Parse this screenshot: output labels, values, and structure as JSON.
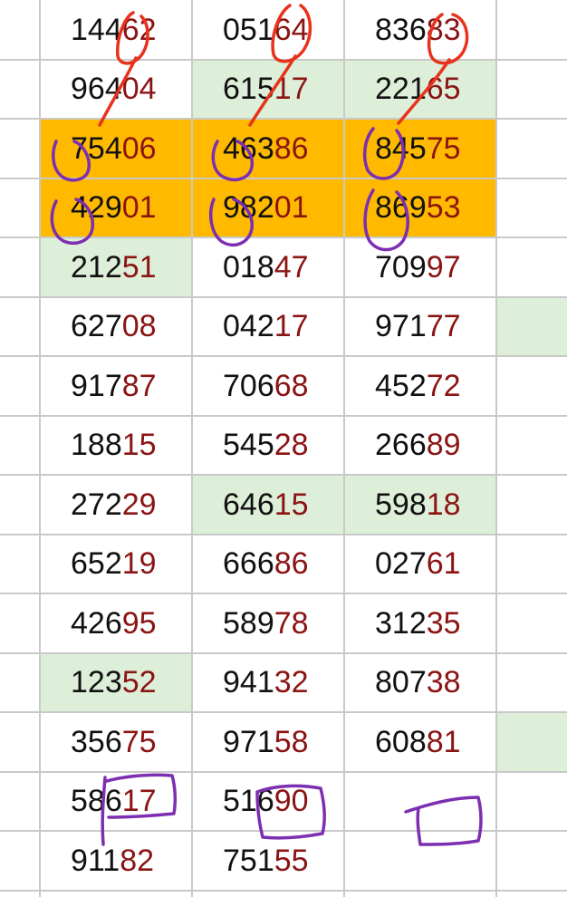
{
  "colors": {
    "grid": "#c9c9c9",
    "high_digits": "#111111",
    "low_digits": "#8b1414",
    "green_fill": "#deefd9",
    "orange_fill": "#ffba00",
    "red_ink": "#e8321c",
    "purple_ink": "#7c2fb0"
  },
  "columns": [
    {
      "cells": [
        {
          "high": "144",
          "low": "62"
        },
        {
          "high": "964",
          "low": "04"
        },
        {
          "high": "754",
          "low": "06",
          "fill": "orange"
        },
        {
          "high": "429",
          "low": "01",
          "fill": "orange"
        },
        {
          "high": "212",
          "low": "51",
          "fill": "green"
        },
        {
          "high": "627",
          "low": "08"
        },
        {
          "high": "917",
          "low": "87"
        },
        {
          "high": "188",
          "low": "15"
        },
        {
          "high": "272",
          "low": "29"
        },
        {
          "high": "652",
          "low": "19"
        },
        {
          "high": "426",
          "low": "95"
        },
        {
          "high": "123",
          "low": "52",
          "fill": "green"
        },
        {
          "high": "356",
          "low": "75"
        },
        {
          "high": "586",
          "low": "17"
        },
        {
          "high": "911",
          "low": "82"
        }
      ]
    },
    {
      "cells": [
        {
          "high": "051",
          "low": "64"
        },
        {
          "high": "615",
          "low": "17",
          "fill": "green"
        },
        {
          "high": "463",
          "low": "86",
          "fill": "orange"
        },
        {
          "high": "982",
          "low": "01",
          "fill": "orange"
        },
        {
          "high": "018",
          "low": "47"
        },
        {
          "high": "042",
          "low": "17"
        },
        {
          "high": "706",
          "low": "68"
        },
        {
          "high": "545",
          "low": "28"
        },
        {
          "high": "646",
          "low": "15",
          "fill": "green"
        },
        {
          "high": "666",
          "low": "86"
        },
        {
          "high": "589",
          "low": "78"
        },
        {
          "high": "941",
          "low": "32"
        },
        {
          "high": "971",
          "low": "58"
        },
        {
          "high": "516",
          "low": "90"
        },
        {
          "high": "751",
          "low": "55"
        }
      ]
    },
    {
      "cells": [
        {
          "high": "836",
          "low": "83"
        },
        {
          "high": "221",
          "low": "65",
          "fill": "green"
        },
        {
          "high": "845",
          "low": "75",
          "fill": "orange"
        },
        {
          "high": "869",
          "low": "53",
          "fill": "orange"
        },
        {
          "high": "709",
          "low": "97"
        },
        {
          "high": "971",
          "low": "77"
        },
        {
          "high": "452",
          "low": "72"
        },
        {
          "high": "266",
          "low": "89"
        },
        {
          "high": "598",
          "low": "18",
          "fill": "green"
        },
        {
          "high": "027",
          "low": "61"
        },
        {
          "high": "312",
          "low": "35"
        },
        {
          "high": "807",
          "low": "38"
        },
        {
          "high": "608",
          "low": "81"
        },
        {
          "high": "",
          "low": ""
        },
        {
          "high": "",
          "low": ""
        }
      ]
    }
  ],
  "side_column": {
    "green_rows": [
      5,
      12
    ]
  }
}
